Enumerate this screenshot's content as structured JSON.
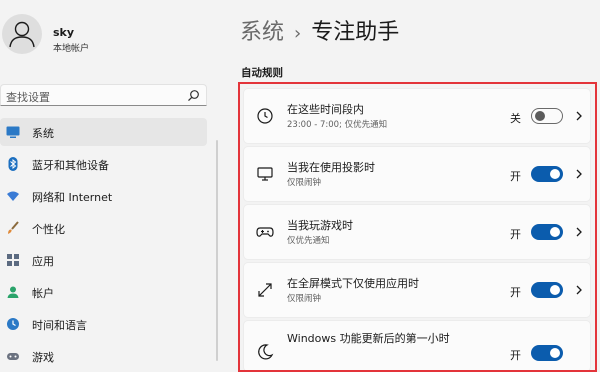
{
  "user": {
    "name": "sky",
    "account_type": "本地帐户"
  },
  "search": {
    "placeholder": "查找设置"
  },
  "sidebar": {
    "items": [
      {
        "label": "系统",
        "icon": "monitor-icon",
        "active": true
      },
      {
        "label": "蓝牙和其他设备",
        "icon": "bluetooth-icon"
      },
      {
        "label": "网络和 Internet",
        "icon": "wifi-icon"
      },
      {
        "label": "个性化",
        "icon": "brush-icon"
      },
      {
        "label": "应用",
        "icon": "apps-icon"
      },
      {
        "label": "帐户",
        "icon": "person-icon"
      },
      {
        "label": "时间和语言",
        "icon": "globe-clock-icon"
      },
      {
        "label": "游戏",
        "icon": "game-icon"
      }
    ]
  },
  "breadcrumb": {
    "parent": "系统",
    "separator": "›",
    "current": "专注助手"
  },
  "section": {
    "title": "自动规则"
  },
  "rules": [
    {
      "title": "在这些时间段内",
      "subtitle": "23:00 - 7:00; 仅优先通知",
      "state": "关",
      "enabled": false,
      "icon": "clock-icon"
    },
    {
      "title": "当我在使用投影时",
      "subtitle": "仅限闹钟",
      "state": "开",
      "enabled": true,
      "icon": "projector-monitor-icon"
    },
    {
      "title": "当我玩游戏时",
      "subtitle": "仅优先通知",
      "state": "开",
      "enabled": true,
      "icon": "gamepad-icon"
    },
    {
      "title": "在全屏模式下仅使用应用时",
      "subtitle": "仅限闹钟",
      "state": "开",
      "enabled": true,
      "icon": "fullscreen-icon"
    },
    {
      "title": "Windows 功能更新后的第一小时",
      "subtitle": "",
      "state": "开",
      "enabled": true,
      "icon": "moon-icon"
    }
  ],
  "colors": {
    "accent": "#0b5cad",
    "highlight_frame": "#e3343a",
    "background": "#f3f3f3"
  }
}
